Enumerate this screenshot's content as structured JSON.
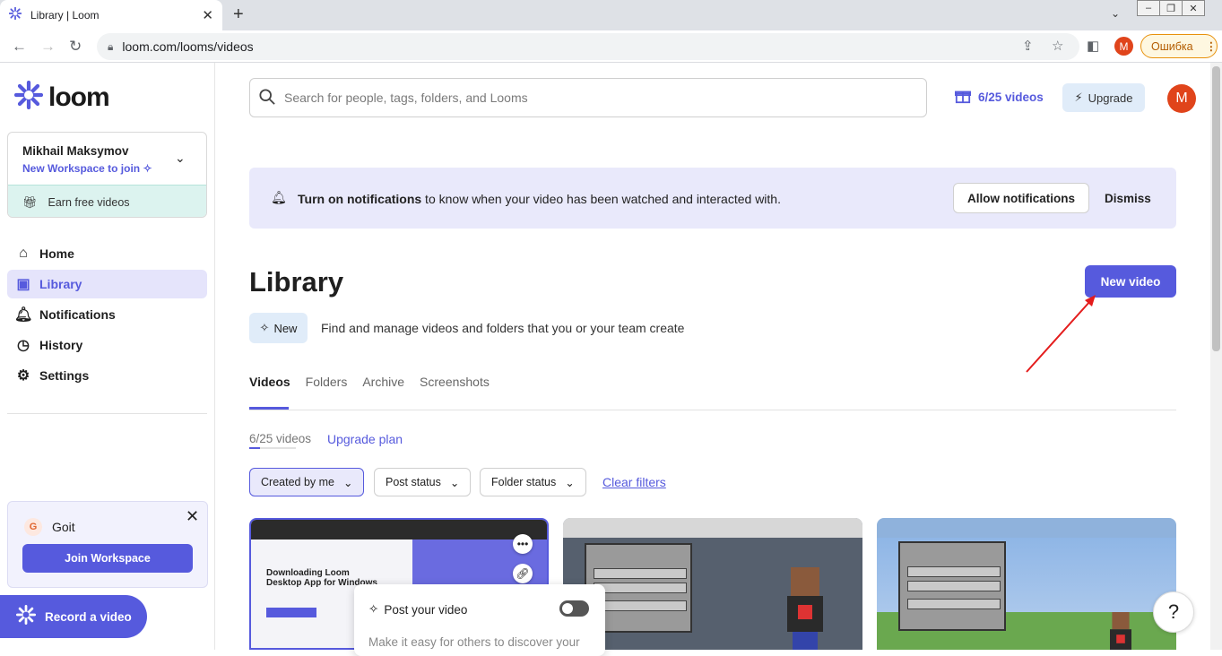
{
  "browser": {
    "tab_title": "Library | Loom",
    "url": "loom.com/looms/videos",
    "profile_initial": "M",
    "error_label": "Ошибка"
  },
  "sidebar": {
    "brand": "loom",
    "workspace": {
      "name": "Mikhail Maksymov",
      "join_label": "New Workspace to join",
      "earn_label": "Earn free videos"
    },
    "nav": [
      {
        "label": "Home",
        "icon": "home-icon"
      },
      {
        "label": "Library",
        "icon": "library-icon",
        "active": true
      },
      {
        "label": "Notifications",
        "icon": "bell-icon"
      },
      {
        "label": "History",
        "icon": "clock-icon"
      },
      {
        "label": "Settings",
        "icon": "gear-icon"
      }
    ],
    "invite": {
      "initial": "G",
      "name": "Goit",
      "button": "Join Workspace"
    },
    "record_button": "Record a video"
  },
  "header": {
    "search_placeholder": "Search for people, tags, folders, and Looms",
    "quota": "6/25 videos",
    "upgrade": "Upgrade",
    "avatar_initial": "M"
  },
  "banner": {
    "bold": "Turn on notifications",
    "text": " to know when your video has been watched and interacted with.",
    "allow": "Allow notifications",
    "dismiss": "Dismiss"
  },
  "library": {
    "title": "Library",
    "new_video": "New video",
    "new_badge": "New",
    "subtitle": "Find and manage videos and folders that you or your team create",
    "tabs": [
      "Videos",
      "Folders",
      "Archive",
      "Screenshots"
    ],
    "count": "6/25 videos",
    "count_fraction": 0.24,
    "upgrade_plan": "Upgrade plan",
    "filters": [
      "Created by me",
      "Post status",
      "Folder status"
    ],
    "clear_filters": "Clear filters"
  },
  "videos": [
    {
      "thumb_title": "Downloading Loom Desktop App for Windows"
    }
  ],
  "post_card": {
    "title": "Post your video",
    "description": "Make it easy for others to discover your"
  },
  "help_label": "?",
  "colors": {
    "accent": "#565add",
    "teal": "#dcf3ef",
    "banner": "#e9e9fb"
  }
}
